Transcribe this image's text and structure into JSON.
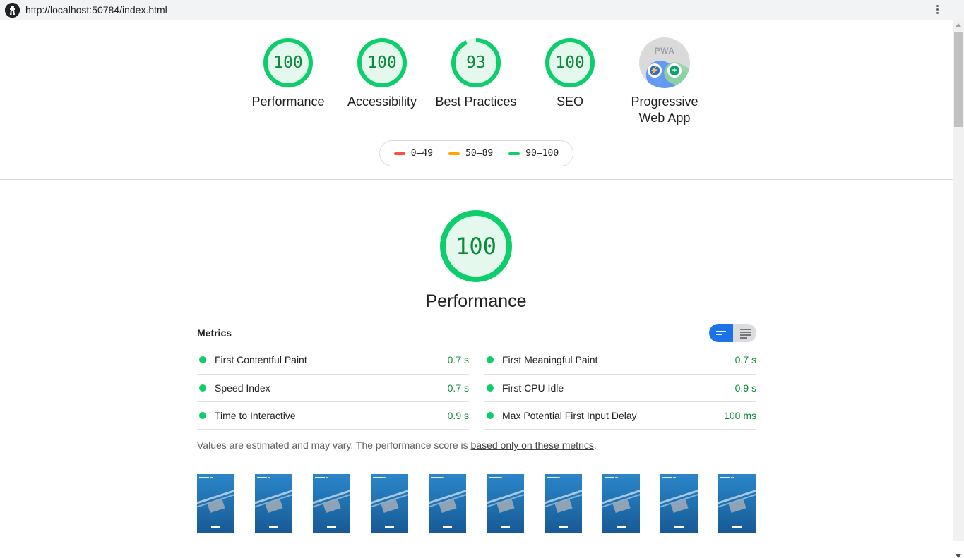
{
  "browser": {
    "url": "http://localhost:50784/index.html"
  },
  "gauges": [
    {
      "label": "Performance",
      "score": "100",
      "fraction": 1.0
    },
    {
      "label": "Accessibility",
      "score": "100",
      "fraction": 1.0
    },
    {
      "label": "Best Practices",
      "score": "93",
      "fraction": 0.93
    },
    {
      "label": "SEO",
      "score": "100",
      "fraction": 1.0
    }
  ],
  "pwa": {
    "badge_text": "PWA",
    "label_line1": "Progressive",
    "label_line2": "Web App"
  },
  "legend": [
    {
      "range": "0–49",
      "color": "#ff4e42"
    },
    {
      "range": "50–89",
      "color": "#ffa400"
    },
    {
      "range": "90–100",
      "color": "#0cce6b"
    }
  ],
  "category": {
    "score": "100",
    "fraction": 1.0,
    "title": "Performance"
  },
  "metrics": {
    "title": "Metrics",
    "left": [
      {
        "name": "First Contentful Paint",
        "value": "0.7 s"
      },
      {
        "name": "Speed Index",
        "value": "0.7 s"
      },
      {
        "name": "Time to Interactive",
        "value": "0.9 s"
      }
    ],
    "right": [
      {
        "name": "First Meaningful Paint",
        "value": "0.7 s"
      },
      {
        "name": "First CPU Idle",
        "value": "0.9 s"
      },
      {
        "name": "Max Potential First Input Delay",
        "value": "100 ms"
      }
    ]
  },
  "note": {
    "text": "Values are estimated and may vary. The performance score is ",
    "link": "based only on these metrics",
    "end": "."
  },
  "filmstrip_count": 10,
  "colors": {
    "pass_green": "#0cce6b",
    "pass_text": "#0b8a39",
    "gauge_fill": "#e5f8ed",
    "toggle_active": "#1a73e8"
  }
}
